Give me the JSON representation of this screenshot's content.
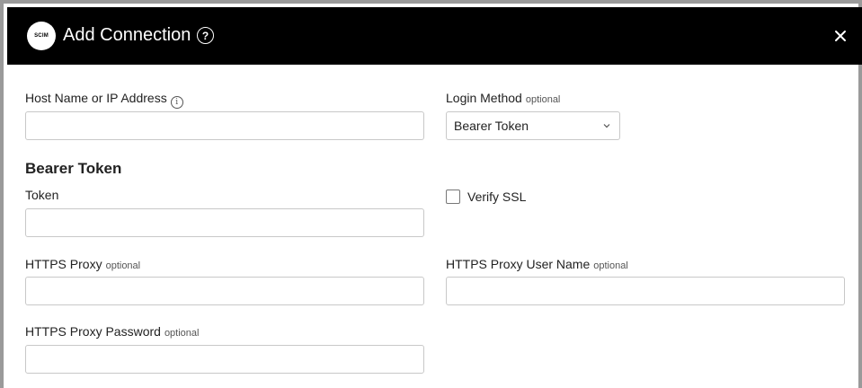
{
  "dialog": {
    "title": "Add Connection",
    "logo_text": "SCIM",
    "help_icon": "question-circle-icon",
    "close_icon": "close-icon"
  },
  "fields": {
    "host": {
      "label": "Host Name or IP Address",
      "value": "",
      "info_icon": "info-icon"
    },
    "login_method": {
      "label": "Login Method",
      "optional": "optional",
      "value": "Bearer Token"
    },
    "section_heading": "Bearer Token",
    "token": {
      "label": "Token",
      "value": ""
    },
    "verify_ssl": {
      "label": "Verify SSL",
      "checked": false
    },
    "https_proxy": {
      "label": "HTTPS Proxy",
      "optional": "optional",
      "value": ""
    },
    "https_proxy_user": {
      "label": "HTTPS Proxy User Name",
      "optional": "optional",
      "value": ""
    },
    "https_proxy_password": {
      "label": "HTTPS Proxy Password",
      "optional": "optional",
      "value": ""
    }
  },
  "colors": {
    "header_bg": "#000000",
    "header_text": "#ffffff",
    "border": "#c8c8c8"
  }
}
